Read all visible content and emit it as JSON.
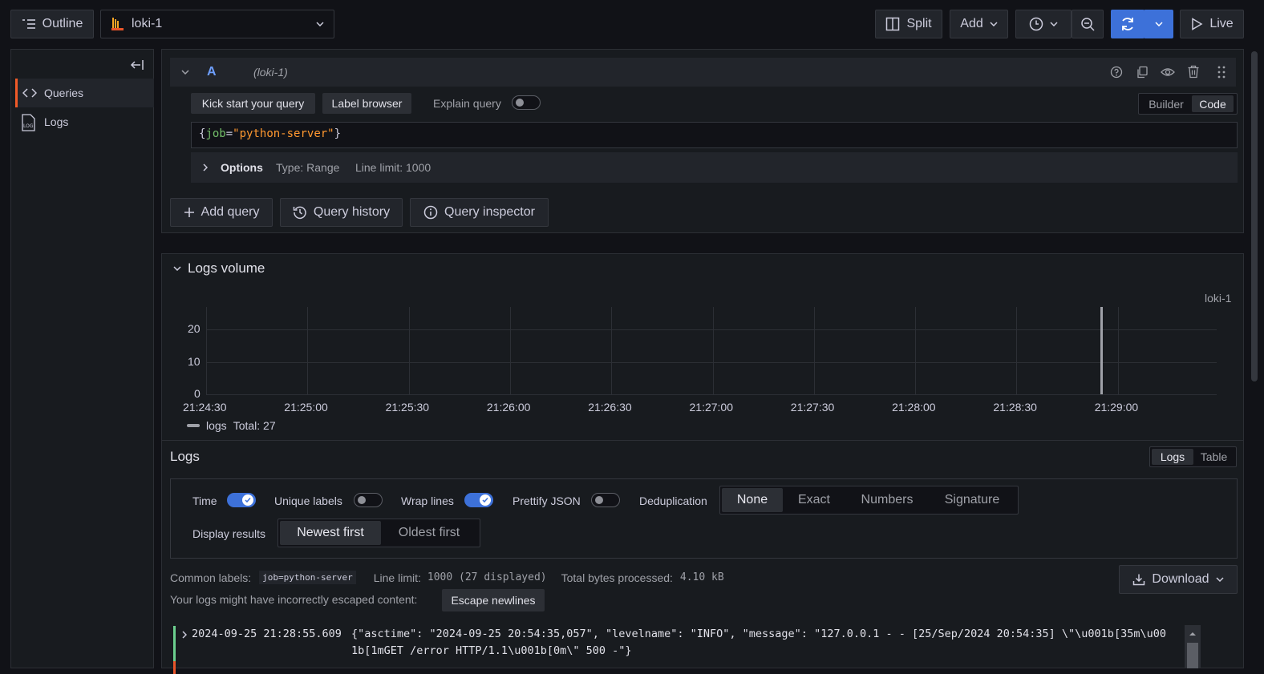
{
  "toolbar": {
    "outline_label": "Outline",
    "datasource": "loki-1",
    "split_label": "Split",
    "add_label": "Add",
    "live_label": "Live"
  },
  "sidebar": {
    "items": [
      {
        "label": "Queries",
        "icon": "code-icon",
        "active": true
      },
      {
        "label": "Logs",
        "icon": "logs-icon",
        "active": false
      }
    ]
  },
  "query": {
    "ref_id": "A",
    "datasource_label": "(loki-1)",
    "kick_start_label": "Kick start your query",
    "label_browser_label": "Label browser",
    "explain_label": "Explain query",
    "builder_label": "Builder",
    "code_label": "Code",
    "expr": {
      "open": "{",
      "key": "job",
      "eq": "=",
      "value": "\"python-server\"",
      "close": "}"
    },
    "options_label": "Options",
    "options_type": "Type: Range",
    "options_limit": "Line limit: 1000"
  },
  "actions": {
    "add_query": "Add query",
    "query_history": "Query history",
    "query_inspector": "Query inspector"
  },
  "volume": {
    "title": "Logs volume",
    "source_label": "loki-1"
  },
  "chart_data": {
    "type": "bar",
    "x_ticks": [
      "21:24:30",
      "21:25:00",
      "21:25:30",
      "21:26:00",
      "21:26:30",
      "21:27:00",
      "21:27:30",
      "21:28:00",
      "21:28:30",
      "21:29:00"
    ],
    "y_ticks": [
      "0",
      "10",
      "20"
    ],
    "ylim": [
      0,
      27
    ],
    "series": [
      {
        "name": "logs",
        "x": [
          "21:28:55"
        ],
        "values": [
          27
        ],
        "color": "#9fa1a8"
      }
    ],
    "legend": {
      "name": "logs",
      "total": "Total: 27"
    },
    "grid": true
  },
  "logs": {
    "title": "Logs",
    "view_logs": "Logs",
    "view_table": "Table",
    "time_label": "Time",
    "unique_labels_label": "Unique labels",
    "wrap_lines_label": "Wrap lines",
    "prettify_label": "Prettify JSON",
    "dedup_label": "Deduplication",
    "dedup_options": [
      "None",
      "Exact",
      "Numbers",
      "Signature"
    ],
    "display_label": "Display results",
    "order_options": [
      "Newest first",
      "Oldest first"
    ],
    "common_labels_key": "Common labels:",
    "common_labels_value": "job=python-server",
    "line_limit_key": "Line limit:",
    "line_limit_value": "1000 (27 displayed)",
    "bytes_key": "Total bytes processed:",
    "bytes_value": "4.10 kB",
    "escape_warning": "Your logs might have incorrectly escaped content:",
    "escape_button": "Escape newlines",
    "download_label": "Download",
    "rows": [
      {
        "timestamp": "2024-09-25 21:28:55.609",
        "line1": "{\"asctime\": \"2024-09-25 20:54:35,057\", \"levelname\": \"INFO\", \"message\": \"127.0.0.1 - - [25/Sep/2024 20:54:35] \\\"\\u001b[35m\\u00",
        "line2": "1b[1mGET /error HTTP/1.1\\u001b[0m\\\" 500 -\"}"
      }
    ]
  },
  "colors": {
    "accent": "#3d71d9",
    "active_tab": "#f05a28",
    "log_level_info": "#6ccf8e"
  }
}
